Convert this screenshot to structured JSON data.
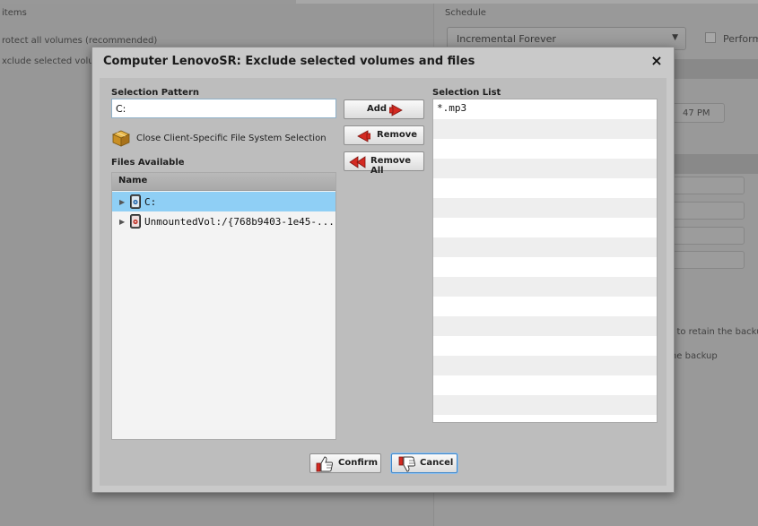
{
  "background": {
    "left_header": "items",
    "right_header": "Schedule",
    "option_protect_all": "rotect all volumes (recommended)",
    "option_exclude": "xclude selected volume",
    "schedule_select": "Incremental Forever",
    "perform_label": "Perform",
    "retain_text_1": "pt to retain the backup",
    "retain_text_2": "the backup",
    "time_value": "47 PM"
  },
  "dialog": {
    "title": "Computer LenovoSR: Exclude selected volumes and files",
    "close_symbol": "×",
    "selection_pattern_label": "Selection Pattern",
    "selection_pattern_value": "C:",
    "close_client_label": "Close Client-Specific File System Selection",
    "files_available_label": "Files Available",
    "files_column_name": "Name",
    "files": [
      {
        "label": "C:"
      },
      {
        "label": "UnmountedVol:/{768b9403-1e45-..."
      }
    ],
    "buttons": {
      "add": "Add",
      "remove": "Remove",
      "remove_all": "Remove All",
      "confirm": "Confirm",
      "cancel": "Cancel"
    },
    "selection_list_label": "Selection List",
    "selection_list": [
      "*.mp3"
    ]
  },
  "colors": {
    "accent_red": "#d42a22",
    "selected_row": "#8fcff5",
    "focus_blue": "#3f86c9"
  }
}
